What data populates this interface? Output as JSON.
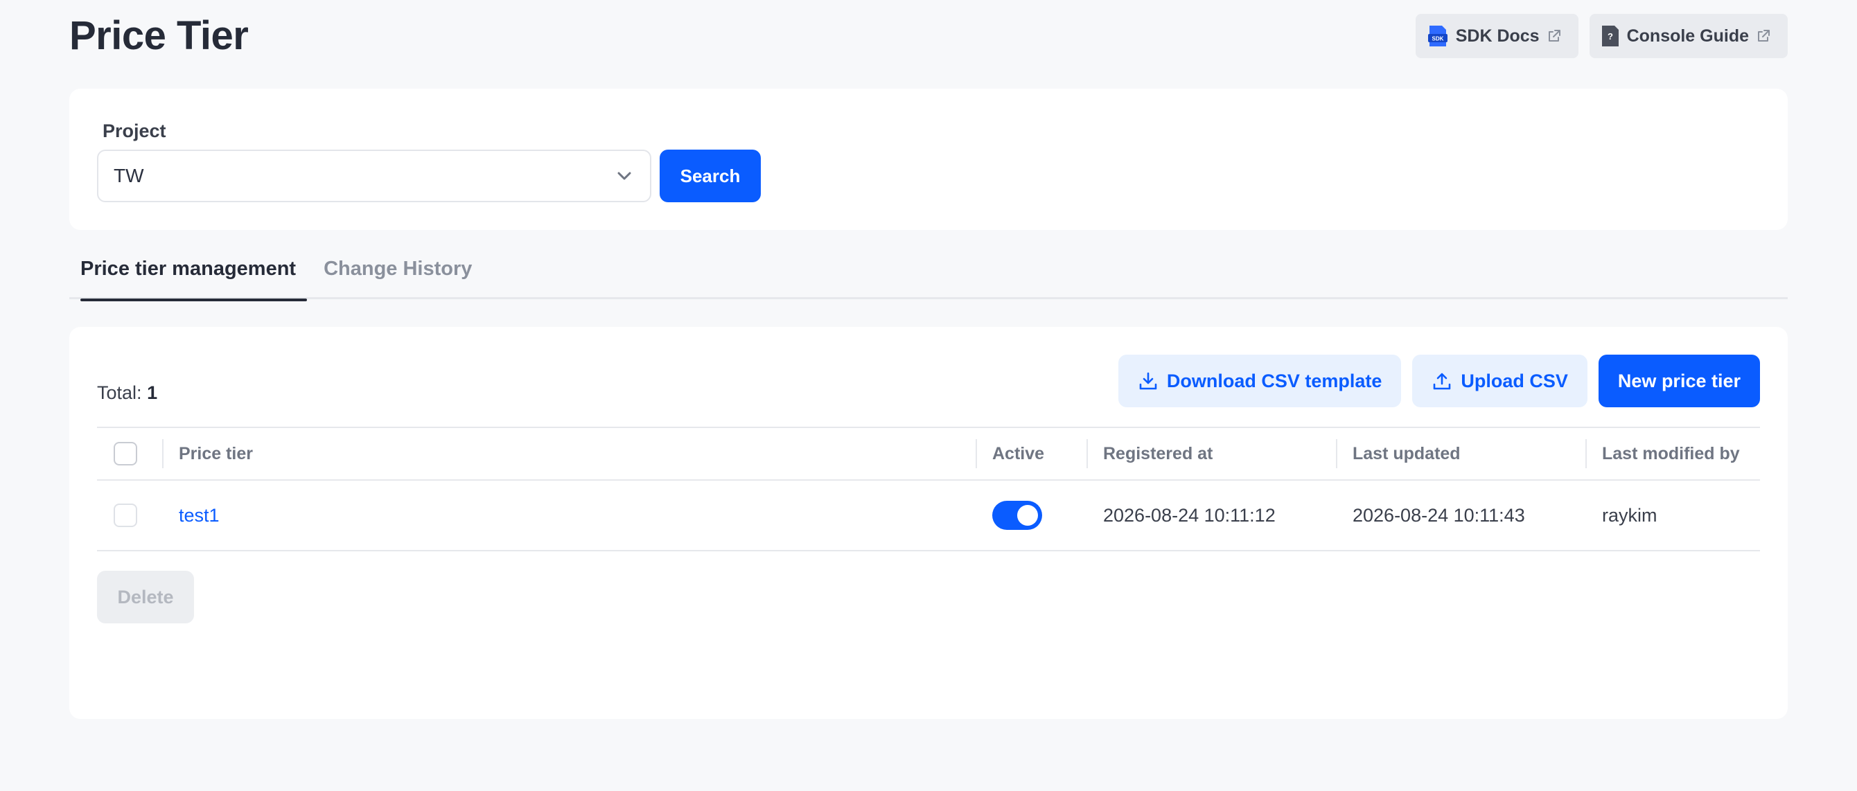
{
  "header": {
    "title": "Price Tier",
    "links": {
      "sdk_docs": "SDK Docs",
      "sdk_icon_text": "SDK",
      "console_guide": "Console Guide",
      "guide_icon_text": "?"
    }
  },
  "search": {
    "project_label": "Project",
    "project_value": "TW",
    "search_button": "Search"
  },
  "tabs": [
    {
      "label": "Price tier management",
      "active": true
    },
    {
      "label": "Change History",
      "active": false
    }
  ],
  "list": {
    "total_label": "Total:",
    "total_count": "1",
    "actions": {
      "download_csv": "Download CSV template",
      "upload_csv": "Upload CSV",
      "new_price_tier": "New price tier"
    },
    "columns": {
      "price_tier": "Price tier",
      "active": "Active",
      "registered_at": "Registered at",
      "last_updated": "Last updated",
      "last_modified_by": "Last modified by"
    },
    "rows": [
      {
        "price_tier": "test1",
        "active": true,
        "registered_at": "2026-08-24 10:11:12",
        "last_updated": "2026-08-24 10:11:43",
        "last_modified_by": "raykim"
      }
    ],
    "delete_button": "Delete"
  },
  "colors": {
    "primary": "#0a5cff",
    "background": "#f7f8fa",
    "light_button": "#e8f1fe"
  }
}
